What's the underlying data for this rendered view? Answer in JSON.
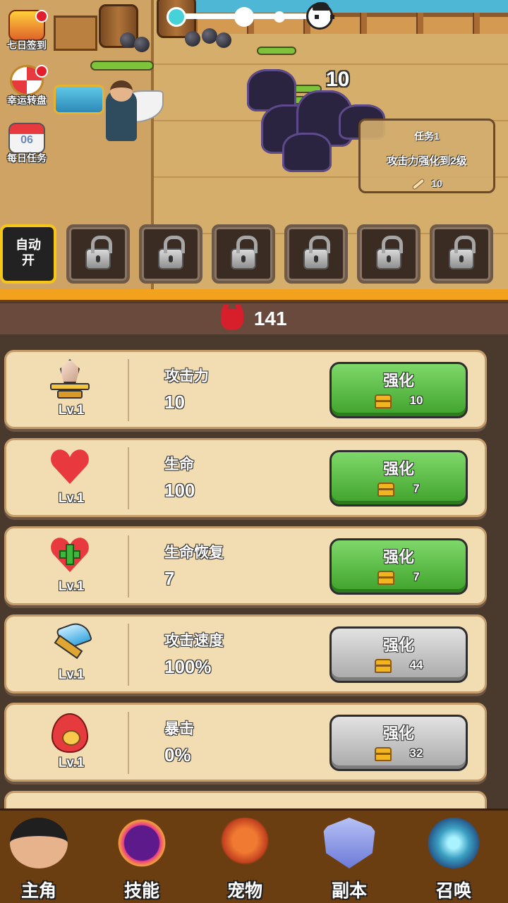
{
  "side_buttons": [
    {
      "label": "七日签到",
      "icon": "gift-box-icon",
      "has_badge": true
    },
    {
      "label": "幸运转盘",
      "icon": "lucky-wheel-icon",
      "has_badge": true
    },
    {
      "label": "每日任务",
      "icon": "calendar-icon",
      "calendar_date": "06",
      "has_badge": false
    }
  ],
  "battle": {
    "damage_number": "10",
    "wave_progress": {
      "nodes": 3,
      "current": 1,
      "boss_icon": "skull-pirate-icon"
    }
  },
  "task": {
    "title": "任务1",
    "description": "攻击力强化到2级",
    "reward": "10",
    "reward_icon": "bone-icon"
  },
  "skill_bar": {
    "auto_label_line1": "自动",
    "auto_label_line2": "开",
    "locked_slots": 6
  },
  "currency": {
    "icon": "devil-icon",
    "value": "141",
    "color": "#d61f2a"
  },
  "upgrades": [
    {
      "name": "攻击力",
      "value": "10",
      "level": "Lv.1",
      "icon": "sword-icon",
      "button_label": "强化",
      "cost": "10",
      "affordable": true
    },
    {
      "name": "生命",
      "value": "100",
      "level": "Lv.1",
      "icon": "heart-icon",
      "button_label": "强化",
      "cost": "7",
      "affordable": true
    },
    {
      "name": "生命恢复",
      "value": "7",
      "level": "Lv.1",
      "icon": "heart-plus-icon",
      "button_label": "强化",
      "cost": "7",
      "affordable": true
    },
    {
      "name": "攻击速度",
      "value": "100%",
      "level": "Lv.1",
      "icon": "axe-icon",
      "button_label": "强化",
      "cost": "44",
      "affordable": false
    },
    {
      "name": "暴击",
      "value": "0%",
      "level": "Lv.1",
      "icon": "fire-icon",
      "button_label": "强化",
      "cost": "32",
      "affordable": false
    }
  ],
  "colors": {
    "button_green": "#3ea22a",
    "button_gray": "#a8a8a8",
    "accent_orange": "#f2a21e"
  },
  "nav": [
    {
      "label": "主角",
      "icon": "pirate-captain-icon"
    },
    {
      "label": "技能",
      "icon": "skill-orb-icon"
    },
    {
      "label": "宠物",
      "icon": "dragon-pet-icon"
    },
    {
      "label": "副本",
      "icon": "dungeon-shield-icon"
    },
    {
      "label": "召唤",
      "icon": "summon-portal-icon"
    }
  ]
}
